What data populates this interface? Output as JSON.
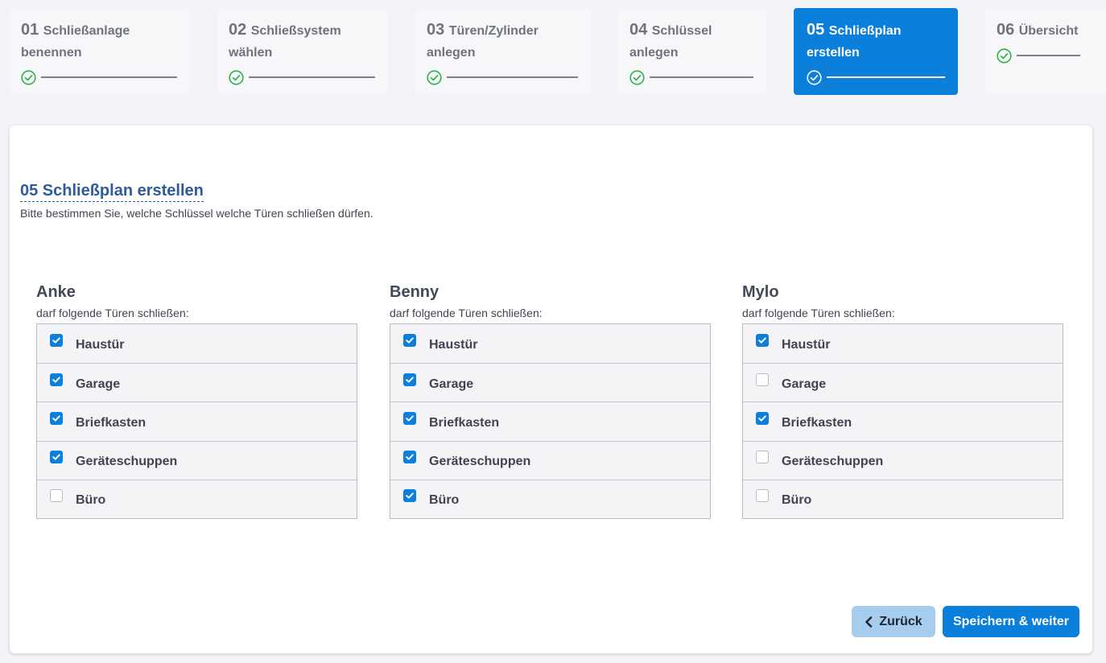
{
  "stepper": {
    "steps": [
      {
        "number": "01",
        "label": "Schließanlage benennen",
        "completed": true,
        "active": false
      },
      {
        "number": "02",
        "label": "Schließsystem wählen",
        "completed": true,
        "active": false
      },
      {
        "number": "03",
        "label": "Türen/Zylinder anlegen",
        "completed": true,
        "active": false
      },
      {
        "number": "04",
        "label": "Schlüssel anlegen",
        "completed": true,
        "active": false
      },
      {
        "number": "05",
        "label": "Schließplan erstellen",
        "completed": true,
        "active": true
      },
      {
        "number": "06",
        "label": "Übersicht",
        "completed": true,
        "active": false
      }
    ]
  },
  "main": {
    "title": "05 Schließplan erstellen",
    "subtitle": "Bitte bestimmen Sie, welche Schlüssel welche Türen schließen dürfen.",
    "keys": [
      {
        "name": "Anke",
        "caption": "darf folgende Türen schließen:",
        "doors": [
          {
            "label": "Haustür",
            "checked": true
          },
          {
            "label": "Garage",
            "checked": true
          },
          {
            "label": "Briefkasten",
            "checked": true
          },
          {
            "label": "Geräteschuppen",
            "checked": true
          },
          {
            "label": "Büro",
            "checked": false
          }
        ]
      },
      {
        "name": "Benny",
        "caption": "darf folgende Türen schließen:",
        "doors": [
          {
            "label": "Haustür",
            "checked": true
          },
          {
            "label": "Garage",
            "checked": true
          },
          {
            "label": "Briefkasten",
            "checked": true
          },
          {
            "label": "Geräteschuppen",
            "checked": true
          },
          {
            "label": "Büro",
            "checked": true
          }
        ]
      },
      {
        "name": "Mylo",
        "caption": "darf folgende Türen schließen:",
        "doors": [
          {
            "label": "Haustür",
            "checked": true
          },
          {
            "label": "Garage",
            "checked": false
          },
          {
            "label": "Briefkasten",
            "checked": true
          },
          {
            "label": "Geräteschuppen",
            "checked": false
          },
          {
            "label": "Büro",
            "checked": false
          }
        ]
      }
    ]
  },
  "actions": {
    "back_label": "Zurück",
    "next_label": "Speichern & weiter"
  },
  "colors": {
    "accent": "#0a7fdc",
    "title": "#2e5c9a",
    "check_green": "#2bb24c",
    "back_button": "#a7cdee"
  },
  "icons": {
    "step_complete": "check-circle-icon",
    "checkbox_checked": "checkmark-icon",
    "back": "chevron-left-icon"
  }
}
